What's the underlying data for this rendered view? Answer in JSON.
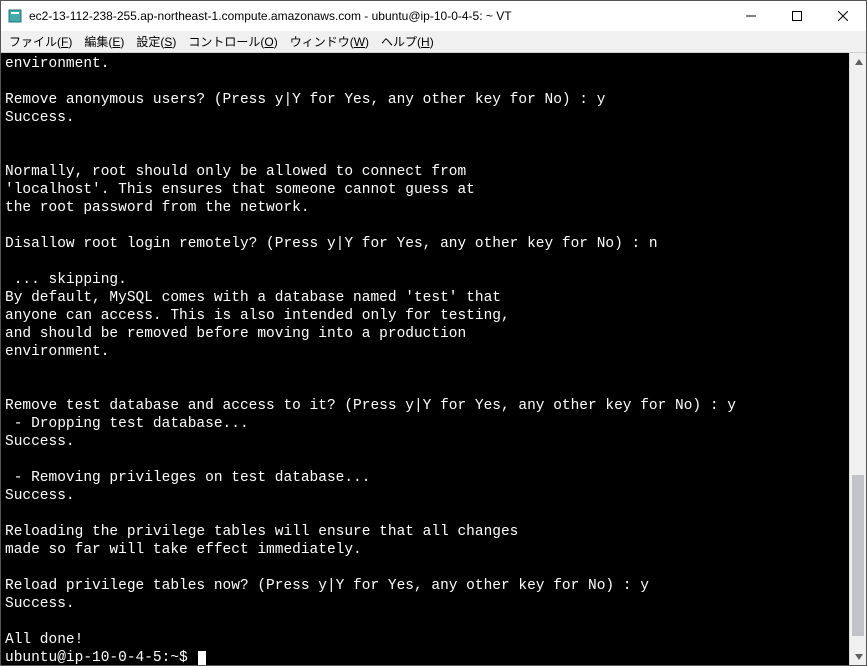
{
  "window": {
    "title": "ec2-13-112-238-255.ap-northeast-1.compute.amazonaws.com - ubuntu@ip-10-0-4-5: ~ VT"
  },
  "menu": {
    "file": {
      "label": "ファイル(",
      "accel": "F",
      "suffix": ")"
    },
    "edit": {
      "label": "編集(",
      "accel": "E",
      "suffix": ")"
    },
    "setup": {
      "label": "設定(",
      "accel": "S",
      "suffix": ")"
    },
    "control": {
      "label": "コントロール(",
      "accel": "O",
      "suffix": ")"
    },
    "window": {
      "label": "ウィンドウ(",
      "accel": "W",
      "suffix": ")"
    },
    "help": {
      "label": "ヘルプ(",
      "accel": "H",
      "suffix": ")"
    }
  },
  "terminal": {
    "content": "environment.\n\nRemove anonymous users? (Press y|Y for Yes, any other key for No) : y\nSuccess.\n\n\nNormally, root should only be allowed to connect from\n'localhost'. This ensures that someone cannot guess at\nthe root password from the network.\n\nDisallow root login remotely? (Press y|Y for Yes, any other key for No) : n\n\n ... skipping.\nBy default, MySQL comes with a database named 'test' that\nanyone can access. This is also intended only for testing,\nand should be removed before moving into a production\nenvironment.\n\n\nRemove test database and access to it? (Press y|Y for Yes, any other key for No) : y\n - Dropping test database...\nSuccess.\n\n - Removing privileges on test database...\nSuccess.\n\nReloading the privilege tables will ensure that all changes\nmade so far will take effect immediately.\n\nReload privilege tables now? (Press y|Y for Yes, any other key for No) : y\nSuccess.\n\nAll done!",
    "prompt": "ubuntu@ip-10-0-4-5:~$ "
  }
}
